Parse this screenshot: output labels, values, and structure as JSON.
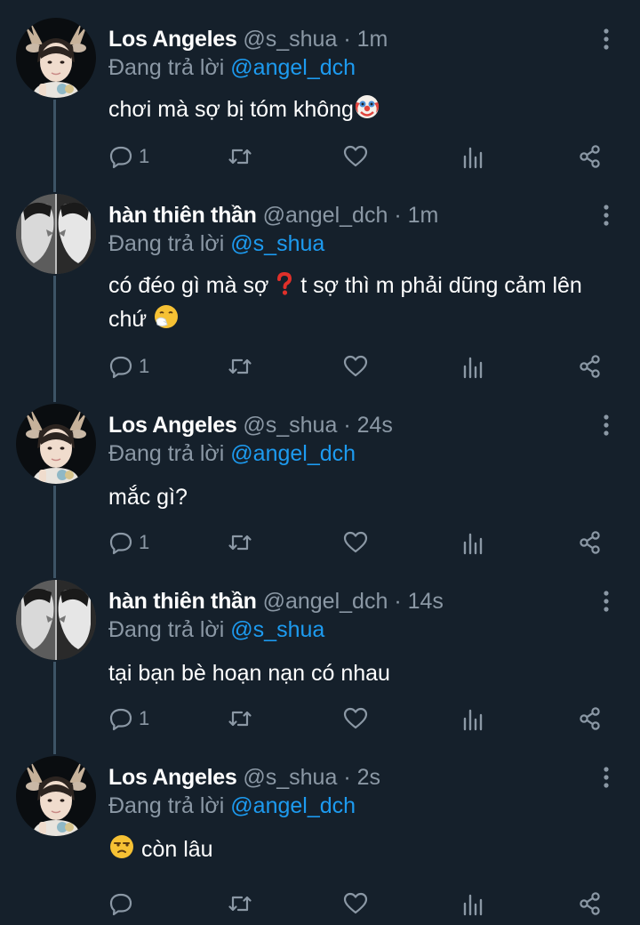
{
  "tweets": [
    {
      "name": "Los Angeles",
      "handle": "@s_shua",
      "time": "1m",
      "reply_prefix": "Đang trả lời",
      "reply_to": "@angel_dch",
      "text": "chơi mà sợ bị tóm không",
      "text_emoji": "clown-face",
      "reply_count": "1",
      "avatar": "deer-antler-boy"
    },
    {
      "name": "hàn thiên thần",
      "handle": "@angel_dch",
      "time": "1m",
      "reply_prefix": "Đang trả lời",
      "reply_to": "@s_shua",
      "text_part1": "có đéo gì mà sợ",
      "text_emoji1": "red-question-mark",
      "text_part2": " t sợ thì m phải dũng cảm lên",
      "text_part3": "chứ",
      "text_emoji2": "sneezing-face",
      "reply_count": "1",
      "avatar": "mirror-faces-bw"
    },
    {
      "name": "Los Angeles",
      "handle": "@s_shua",
      "time": "24s",
      "reply_prefix": "Đang trả lời",
      "reply_to": "@angel_dch",
      "text": "mắc gì?",
      "reply_count": "1",
      "avatar": "deer-antler-boy"
    },
    {
      "name": "hàn thiên thần",
      "handle": "@angel_dch",
      "time": "14s",
      "reply_prefix": "Đang trả lời",
      "reply_to": "@s_shua",
      "text": "tại bạn bè hoạn nạn có nhau",
      "reply_count": "1",
      "avatar": "mirror-faces-bw"
    },
    {
      "name": "Los Angeles",
      "handle": "@s_shua",
      "time": "2s",
      "reply_prefix": "Đang trả lời",
      "reply_to": "@angel_dch",
      "text": "còn lâu",
      "text_emoji": "unamused-face",
      "reply_count": "",
      "avatar": "deer-antler-boy"
    }
  ],
  "separator": "·",
  "colors": {
    "background": "#15202b",
    "text": "#ffffff",
    "secondary": "#8b98a5",
    "link": "#1d9bf0",
    "thread_line": "#3d5466"
  },
  "icons": [
    "reply-icon",
    "retweet-icon",
    "like-icon",
    "stats-icon",
    "share-icon",
    "more-icon"
  ]
}
